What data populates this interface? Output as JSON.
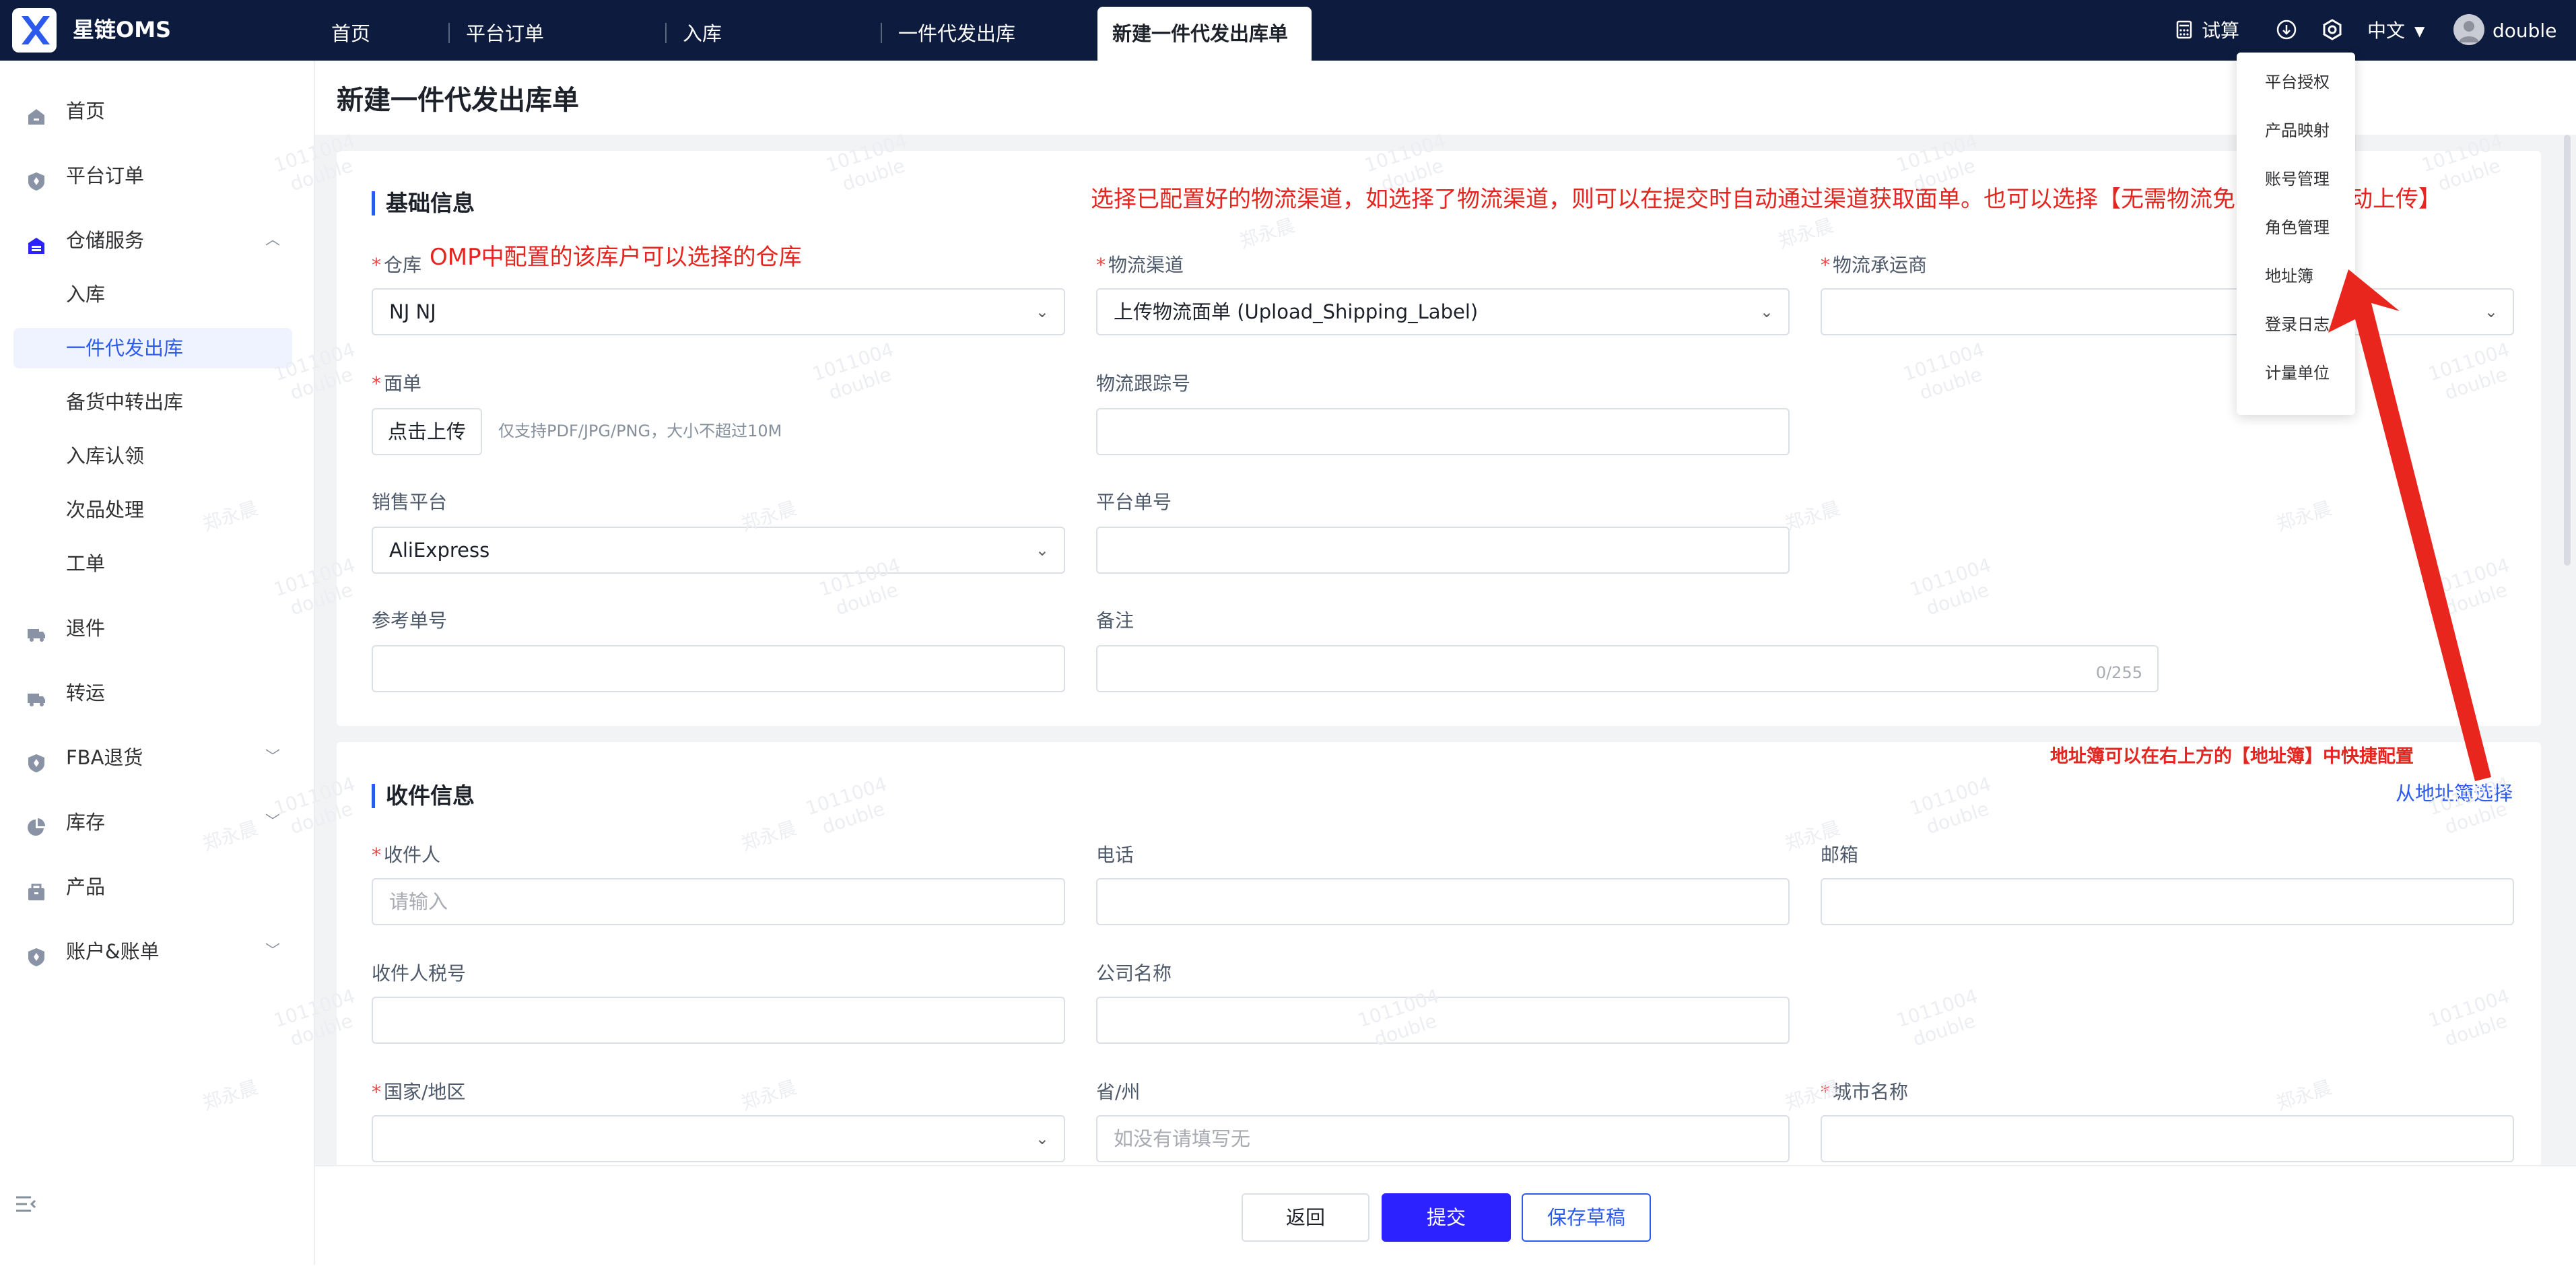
{
  "app": {
    "brand": "星链OMS"
  },
  "topnav": {
    "tabs": [
      {
        "label": "首页"
      },
      {
        "label": "平台订单"
      },
      {
        "label": "入库"
      },
      {
        "label": "一件代发出库"
      },
      {
        "label": "新建一件代发出库单"
      }
    ],
    "calc_label": "试算",
    "language": "中文",
    "user": "double"
  },
  "sidebar": {
    "items": [
      {
        "label": "首页",
        "icon": "home-icon"
      },
      {
        "label": "平台订单",
        "icon": "shield-icon"
      },
      {
        "label": "仓储服务",
        "icon": "warehouse-icon"
      },
      {
        "label": "退件",
        "icon": "truck-icon"
      },
      {
        "label": "转运",
        "icon": "truck-icon"
      },
      {
        "label": "FBA退货",
        "icon": "shield-icon"
      },
      {
        "label": "库存",
        "icon": "pie-icon"
      },
      {
        "label": "产品",
        "icon": "box-icon"
      },
      {
        "label": "账户&账单",
        "icon": "shield-icon"
      }
    ],
    "subitems": [
      {
        "label": "入库"
      },
      {
        "label": "一件代发出库"
      },
      {
        "label": "备货中转出库"
      },
      {
        "label": "入库认领"
      },
      {
        "label": "次品处理"
      },
      {
        "label": "工单"
      }
    ]
  },
  "page": {
    "title": "新建一件代发出库单"
  },
  "basic": {
    "title": "基础信息",
    "warehouse": {
      "label": "仓库",
      "value": "NJ NJ"
    },
    "channel": {
      "label": "物流渠道",
      "value": "上传物流面单 (Upload_Shipping_Label)"
    },
    "carrier": {
      "label": "物流承运商",
      "value": ""
    },
    "label_doc": {
      "label": "面单",
      "button": "点击上传",
      "hint": "仅支持PDF/JPG/PNG，大小不超过10M"
    },
    "tracking": {
      "label": "物流跟踪号",
      "value": ""
    },
    "platform": {
      "label": "销售平台",
      "value": "AliExpress"
    },
    "platform_no": {
      "label": "平台单号",
      "value": ""
    },
    "ref_no": {
      "label": "参考单号",
      "value": ""
    },
    "remark": {
      "label": "备注",
      "value": "",
      "counter": "0/255"
    }
  },
  "receiver": {
    "title": "收件信息",
    "addressbook_link": "从地址簿选择",
    "name": {
      "label": "收件人",
      "placeholder": "请输入"
    },
    "phone": {
      "label": "电话",
      "value": ""
    },
    "email": {
      "label": "邮箱",
      "value": ""
    },
    "tax_no": {
      "label": "收件人税号",
      "value": ""
    },
    "company": {
      "label": "公司名称",
      "value": ""
    },
    "country": {
      "label": "国家/地区",
      "value": ""
    },
    "province": {
      "label": "省/州",
      "placeholder": "如没有请填写无"
    },
    "city": {
      "label": "城市名称",
      "value": ""
    }
  },
  "footer": {
    "back": "返回",
    "submit": "提交",
    "save_draft": "保存草稿"
  },
  "settings_menu": [
    "平台授权",
    "产品映射",
    "账号管理",
    "角色管理",
    "地址簿",
    "登录日志",
    "计量单位"
  ],
  "annotations": {
    "warehouse_note": "OMP中配置的该库户可以选择的仓库",
    "channel_note": "选择已配置好的物流渠道，如选择了物流渠道，则可以在提交时自动通过渠道获取面单。也可以选择【无需物流免单】或【手动上传】",
    "addressbook_note": "地址簿可以在右上方的【地址簿】中快捷配置"
  },
  "watermark": {
    "line1": "郑永晨",
    "line2": "1011004",
    "line3": "double"
  },
  "colors": {
    "topbar": "#0d1b3e",
    "primary": "#2b22ff",
    "accent": "#2b5aed",
    "annotation": "#e5251f",
    "required": "#f53f3f"
  }
}
